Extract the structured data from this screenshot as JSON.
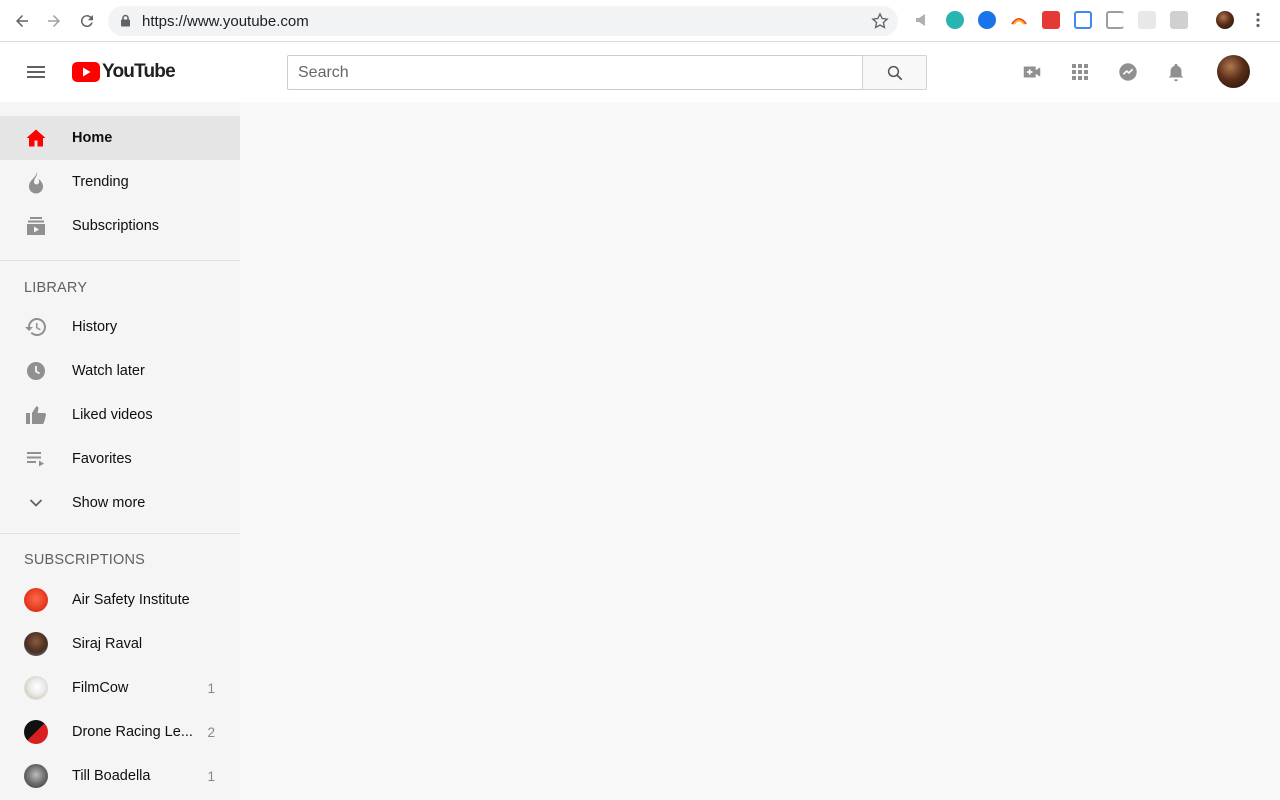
{
  "browser": {
    "url": "https://www.youtube.com"
  },
  "header": {
    "logo_text": "YouTube",
    "search_placeholder": "Search"
  },
  "colors": {
    "brand_red": "#ff0000",
    "icon_gray": "#909090",
    "sidebar_bg": "#f5f5f5",
    "active_bg": "#e5e5e5"
  },
  "sidebar": {
    "main": [
      {
        "label": "Home",
        "icon": "home-icon"
      },
      {
        "label": "Trending",
        "icon": "flame-icon"
      },
      {
        "label": "Subscriptions",
        "icon": "subscriptions-icon"
      }
    ],
    "library_title": "LIBRARY",
    "library": [
      {
        "label": "History",
        "icon": "history-icon"
      },
      {
        "label": "Watch later",
        "icon": "clock-icon"
      },
      {
        "label": "Liked videos",
        "icon": "thumbs-up-icon"
      },
      {
        "label": "Favorites",
        "icon": "playlist-icon"
      },
      {
        "label": "Show more",
        "icon": "chevron-down-icon"
      }
    ],
    "subscriptions_title": "SUBSCRIPTIONS",
    "subscriptions": [
      {
        "label": "Air Safety Institute",
        "count": ""
      },
      {
        "label": "Siraj Raval",
        "count": ""
      },
      {
        "label": "FilmCow",
        "count": "1"
      },
      {
        "label": "Drone Racing Le...",
        "count": "2"
      },
      {
        "label": "Till Boadella",
        "count": "1"
      }
    ]
  }
}
